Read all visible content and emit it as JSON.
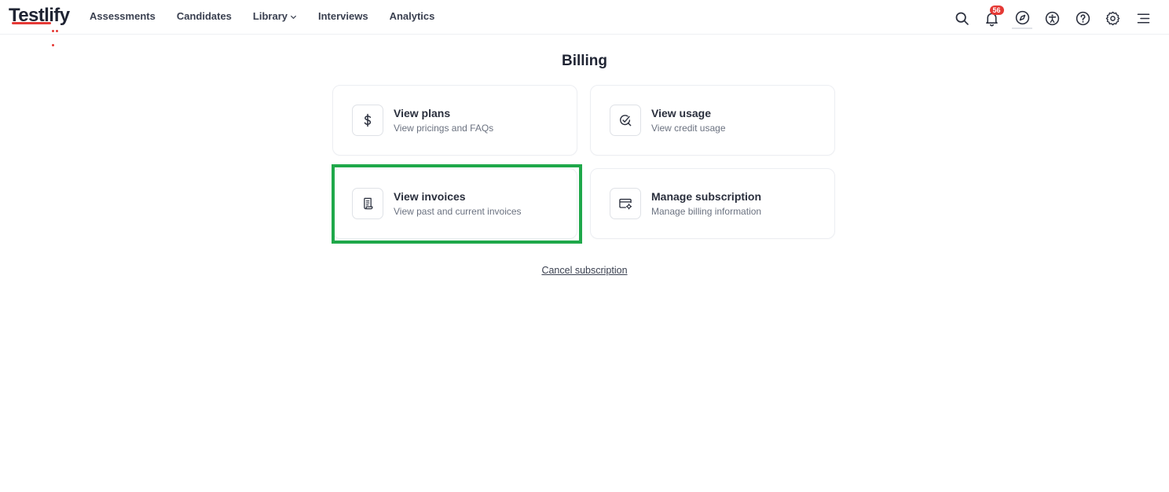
{
  "app": {
    "logo_text": "Testlify",
    "accent_color": "#e53935"
  },
  "nav": {
    "items": [
      {
        "label": "Assessments"
      },
      {
        "label": "Candidates"
      },
      {
        "label": "Library"
      },
      {
        "label": "Interviews"
      },
      {
        "label": "Analytics"
      }
    ]
  },
  "toolbar": {
    "notifications_count": "56",
    "icons": [
      "search-icon",
      "bell-icon",
      "compass-icon",
      "accessibility-icon",
      "help-icon",
      "gear-icon",
      "menu-icon"
    ]
  },
  "page": {
    "title": "Billing",
    "cancel_label": "Cancel subscription"
  },
  "cards": [
    {
      "title": "View plans",
      "subtitle": "View pricings and FAQs",
      "icon": "dollar-icon"
    },
    {
      "title": "View usage",
      "subtitle": "View credit usage",
      "icon": "usage-icon"
    },
    {
      "title": "View invoices",
      "subtitle": "View past and current invoices",
      "icon": "invoice-icon"
    },
    {
      "title": "Manage subscription",
      "subtitle": "Manage billing information",
      "icon": "card-settings-icon"
    }
  ],
  "highlight": {
    "target": "View invoices",
    "color": "#1fa84a"
  }
}
